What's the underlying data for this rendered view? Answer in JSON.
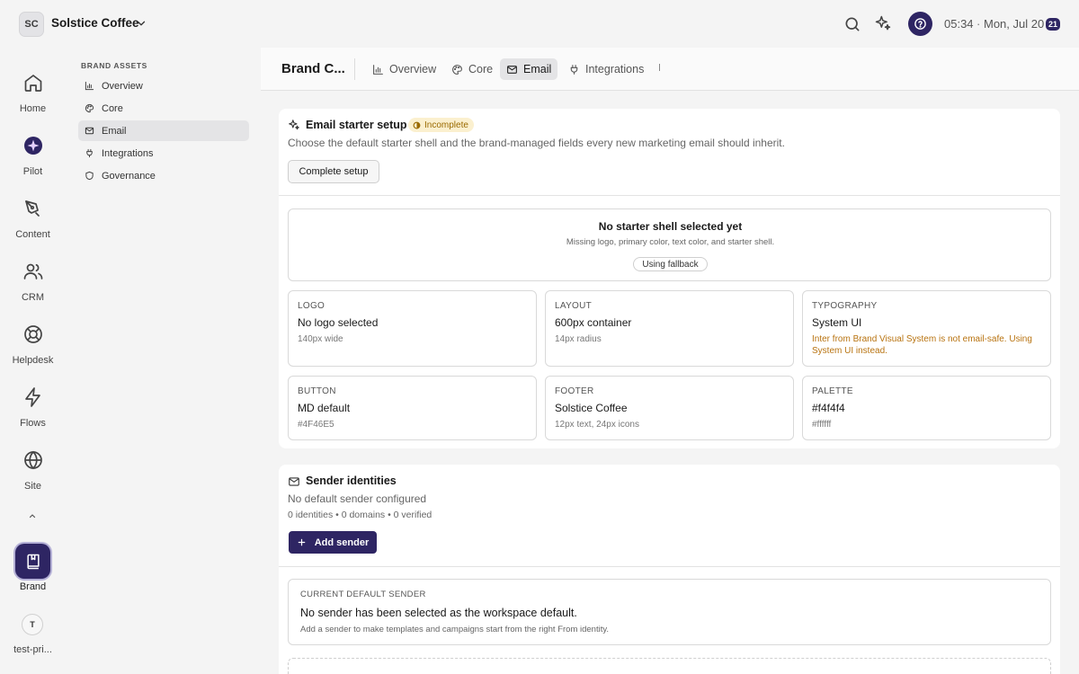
{
  "workspace": {
    "initials": "SC",
    "name": "Solstice Coffee"
  },
  "topbar": {
    "time": "05:34",
    "separator": "·",
    "date": "Mon, Jul 20",
    "badge": "21"
  },
  "rail": {
    "items": [
      {
        "label": "Home",
        "icon": "home-icon"
      },
      {
        "label": "Pilot",
        "icon": "pilot-icon"
      },
      {
        "label": "Content",
        "icon": "pen-icon"
      },
      {
        "label": "CRM",
        "icon": "users-icon"
      },
      {
        "label": "Helpdesk",
        "icon": "lifebuoy-icon"
      },
      {
        "label": "Flows",
        "icon": "bolt-icon"
      },
      {
        "label": "Site",
        "icon": "globe-icon"
      }
    ],
    "brand_label": "Brand",
    "user_initial": "T",
    "user_label": "test-pri..."
  },
  "subnav": {
    "heading": "BRAND ASSETS",
    "items": [
      {
        "label": "Overview",
        "icon": "chart-icon"
      },
      {
        "label": "Core",
        "icon": "palette-icon"
      },
      {
        "label": "Email",
        "icon": "mail-icon",
        "active": true
      },
      {
        "label": "Integrations",
        "icon": "plug-icon"
      },
      {
        "label": "Governance",
        "icon": "shield-icon"
      }
    ]
  },
  "header": {
    "title": "Brand C...",
    "tabs": [
      {
        "label": "Overview",
        "icon": "chart-icon"
      },
      {
        "label": "Core",
        "icon": "palette-icon"
      },
      {
        "label": "Email",
        "icon": "mail-icon",
        "active": true
      },
      {
        "label": "Integrations",
        "icon": "plug-icon"
      }
    ]
  },
  "setup": {
    "title": "Email starter setup",
    "status": "Incomplete",
    "description": "Choose the default starter shell and the brand-managed fields every new marketing email should inherit.",
    "button": "Complete setup",
    "shell": {
      "title": "No starter shell selected yet",
      "subtitle": "Missing logo, primary color, text color, and starter shell.",
      "pill": "Using fallback"
    },
    "tiles": [
      {
        "label": "LOGO",
        "value": "No logo selected",
        "meta": "140px wide"
      },
      {
        "label": "LAYOUT",
        "value": "600px container",
        "meta": "14px radius"
      },
      {
        "label": "TYPOGRAPHY",
        "value": "System UI",
        "warning": "Inter from Brand Visual System is not email-safe. Using System UI instead."
      },
      {
        "label": "BUTTON",
        "value": "MD default",
        "meta": "#4F46E5"
      },
      {
        "label": "FOOTER",
        "value": "Solstice Coffee",
        "meta": "12px text, 24px icons"
      },
      {
        "label": "PALETTE",
        "value": "#f4f4f4",
        "meta": "#ffffff"
      }
    ]
  },
  "senders": {
    "title": "Sender identities",
    "description": "No default sender configured",
    "counts": "0 identities • 0 domains • 0 verified",
    "button": "Add sender",
    "default_label": "CURRENT DEFAULT SENDER",
    "default_title": "No sender has been selected as the workspace default.",
    "default_sub": "Add a sender to make templates and campaigns start from the right From identity."
  },
  "colors": {
    "accent": "#2e2563",
    "warning": "#b87310",
    "badge_bg": "#fbf0cf"
  }
}
